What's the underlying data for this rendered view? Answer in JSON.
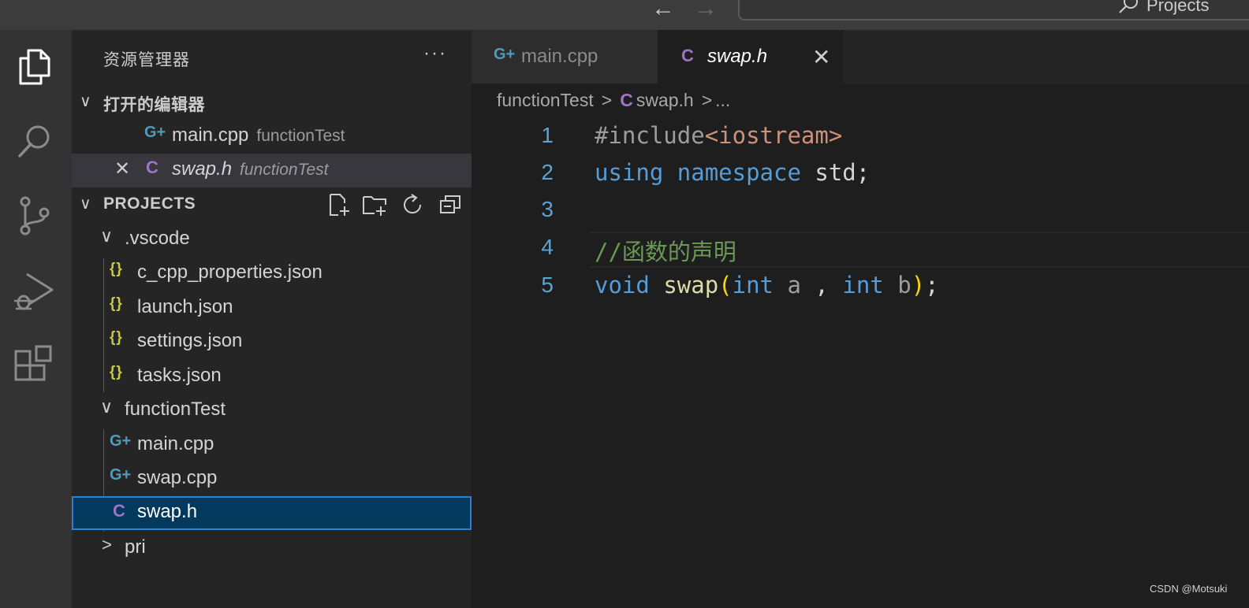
{
  "titlebar": {
    "back": "←",
    "forward": "→",
    "command_center_label": "Projects"
  },
  "sidebar": {
    "title": "资源管理器",
    "more": "···",
    "open_editors": {
      "header": "打开的编辑器",
      "items": [
        {
          "name": "main.cpp",
          "folder": "functionTest",
          "icon": "cpp-icon"
        },
        {
          "name": "swap.h",
          "folder": "functionTest",
          "icon": "c-header-icon",
          "close": "✕"
        }
      ]
    },
    "projects": {
      "header": "PROJECTS",
      "tree": [
        {
          "label": ".vscode"
        },
        {
          "label": "c_cpp_properties.json"
        },
        {
          "label": "launch.json"
        },
        {
          "label": "settings.json"
        },
        {
          "label": "tasks.json"
        },
        {
          "label": "functionTest"
        },
        {
          "label": "main.cpp"
        },
        {
          "label": "swap.cpp"
        },
        {
          "label": "swap.h"
        },
        {
          "label": "pri"
        }
      ]
    }
  },
  "icons": {
    "cpp": "G+",
    "c": "C",
    "json": "{}"
  },
  "tabs": [
    {
      "label": "main.cpp",
      "icon": "cpp-icon",
      "active": false
    },
    {
      "label": "swap.h",
      "icon": "c-header-icon",
      "active": true,
      "close": "✕"
    }
  ],
  "breadcrumb": {
    "folder": "functionTest",
    "sep": ">",
    "file": "swap.h",
    "more": "..."
  },
  "editor": {
    "line_numbers": [
      "1",
      "2",
      "3",
      "4",
      "5"
    ],
    "lines": {
      "l1": {
        "directive": "#include",
        "header": "<iostream>"
      },
      "l2": {
        "kw1": "using",
        "kw2": "namespace",
        "ident": "std;"
      },
      "l4": {
        "comment": "//函数的声明"
      },
      "l5": {
        "kw": "void",
        "fn": "swap",
        "open": "(",
        "t1": "int",
        "a": "a",
        "comma": ",",
        "t2": "int",
        "b": "b",
        "close": ")",
        "semi": ";"
      }
    }
  },
  "watermark": "CSDN @Motsuki",
  "colors": {
    "activity_bar": "#333333",
    "sidebar": "#252526",
    "editor": "#1e1e1e",
    "selection": "#04395e",
    "keyword": "#569cd6",
    "string": "#ce9178",
    "function": "#dcdcaa",
    "comment": "#6a9955"
  }
}
